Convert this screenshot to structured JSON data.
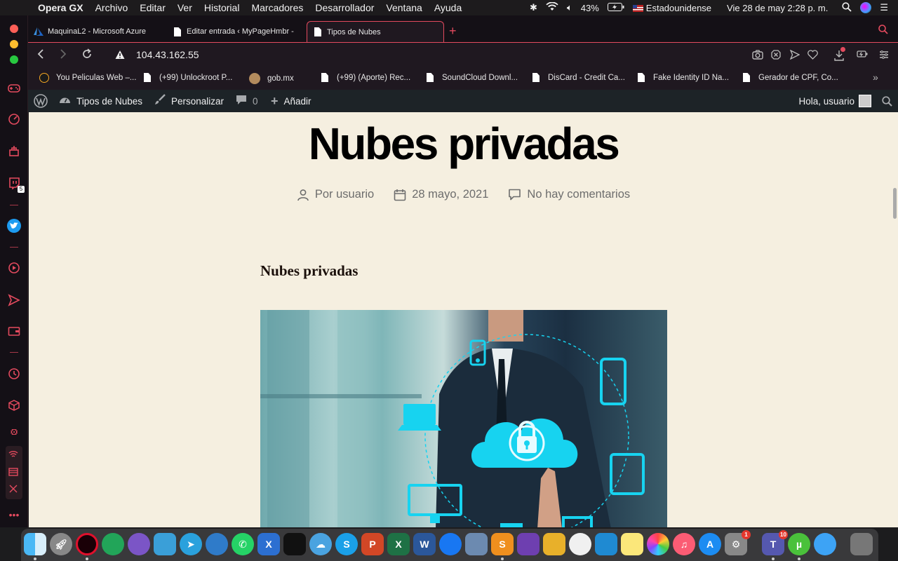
{
  "menubar": {
    "app_name": "Opera GX",
    "menus": [
      "Archivo",
      "Editar",
      "Ver",
      "Historial",
      "Marcadores",
      "Desarrollador",
      "Ventana",
      "Ayuda"
    ],
    "battery": "43%",
    "input_source": "Estadounidense",
    "clock": "Vie 28 de may  2:28 p. m."
  },
  "tabs": [
    {
      "label": "MaquinaL2 - Microsoft Azure",
      "icon": "azure-icon"
    },
    {
      "label": "Editar entrada ‹ MyPageHmbr -",
      "icon": "document-icon"
    },
    {
      "label": "Tipos de Nubes",
      "icon": "document-icon",
      "active": true
    }
  ],
  "address": {
    "url": "104.43.162.55"
  },
  "bookmarks": [
    {
      "label": "You Peliculas Web –..."
    },
    {
      "label": "(+99) Unlockroot P..."
    },
    {
      "label": "gob.mx"
    },
    {
      "label": "(+99) (Aporte) Rec..."
    },
    {
      "label": "SoundCloud Downl..."
    },
    {
      "label": "DisCard - Credit Ca..."
    },
    {
      "label": "Fake Identity ID Na..."
    },
    {
      "label": "Gerador de CPF, Co..."
    }
  ],
  "wp_admin": {
    "site_name": "Tipos de Nubes",
    "customize": "Personalizar",
    "comments_count": "0",
    "add_new": "Añadir",
    "greeting": "Hola, usuario"
  },
  "post": {
    "title": "Nubes privadas",
    "author": "Por usuario",
    "date": "28 mayo, 2021",
    "comments": "No hay comentarios",
    "content_heading": "Nubes privadas"
  },
  "sidebar": {
    "twitch_badge": "5"
  },
  "dock": {
    "teams_badge": "10",
    "prefs_badge": "1"
  },
  "colors": {
    "accent": "#e34a5e",
    "page_bg": "#f5efe0",
    "wp_bar": "#1d2327",
    "cloud_cyan": "#17d3f0"
  }
}
